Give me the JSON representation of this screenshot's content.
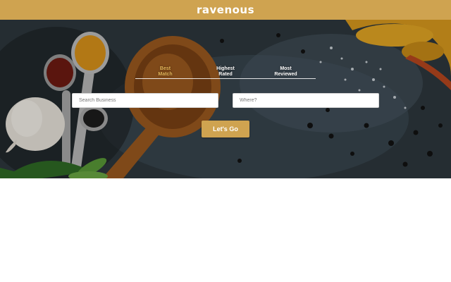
{
  "header": {
    "brand": "ravenous"
  },
  "sort_tabs": [
    {
      "line1": "Best",
      "line2": "Match",
      "active": true
    },
    {
      "line1": "Highest",
      "line2": "Rated",
      "active": false
    },
    {
      "line1": "Most",
      "line2": "Reviewed",
      "active": false
    }
  ],
  "search": {
    "business_placeholder": "Search Business",
    "location_placeholder": "Where?",
    "submit_label": "Let's Go"
  },
  "colors": {
    "accent": "#cfa350",
    "active_tab": "#e8b85a"
  },
  "hero": {
    "image_description_icon": "spices-background-image"
  }
}
